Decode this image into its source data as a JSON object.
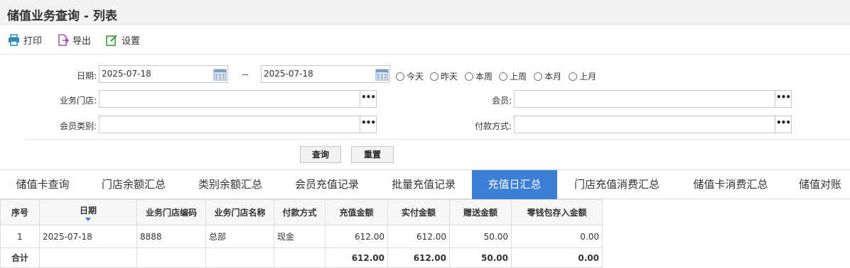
{
  "page": {
    "title": "储值业务查询 - 列表"
  },
  "toolbar": {
    "print": "打印",
    "export": "导出",
    "settings": "设置"
  },
  "filters": {
    "date_label": "日期:",
    "date_from": "2025-07-18",
    "date_sep": "--",
    "date_to": "2025-07-18",
    "quick_ranges": [
      "今天",
      "昨天",
      "本周",
      "上周",
      "本月",
      "上月"
    ],
    "store_label": "业务门店:",
    "store_value": "",
    "member_label": "会员:",
    "member_value": "",
    "member_type_label": "会员类别:",
    "member_type_value": "",
    "payment_label": "付款方式:",
    "payment_value": "",
    "query_btn": "查询",
    "reset_btn": "重置"
  },
  "tabs": [
    "储值卡查询",
    "门店余额汇总",
    "类别余额汇总",
    "会员充值记录",
    "批量充值记录",
    "充值日汇总",
    "门店充值消费汇总",
    "储值卡消费汇总",
    "储值对账"
  ],
  "active_tab": 5,
  "accent_color": "#3c7fd6",
  "table": {
    "headers": [
      "序号",
      "日期",
      "业务门店编码",
      "业务门店名称",
      "付款方式",
      "充值金额",
      "实付金额",
      "赠送金额",
      "零钱包存入金额"
    ],
    "rows": [
      [
        "1",
        "2025-07-18",
        "8888",
        "总部",
        "现金",
        "612.00",
        "612.00",
        "50.00",
        "0.00"
      ]
    ],
    "total": [
      "合计",
      "",
      "",
      "",
      "",
      "612.00",
      "612.00",
      "50.00",
      "0.00"
    ]
  }
}
